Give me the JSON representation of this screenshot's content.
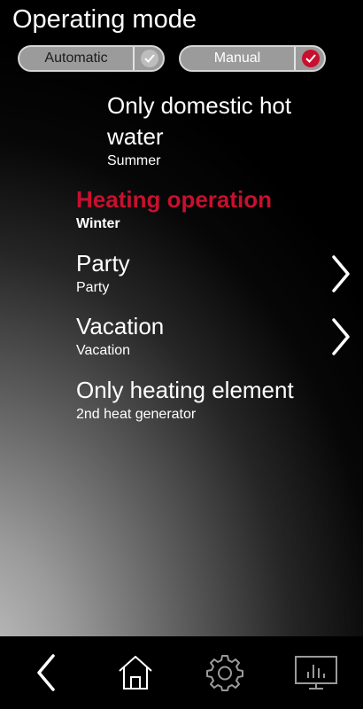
{
  "header": {
    "title": "Operating mode"
  },
  "mode_toggle": {
    "automatic_label": "Automatic",
    "manual_label": "Manual",
    "selected": "Manual"
  },
  "modes": [
    {
      "title_line1": "Only domestic hot",
      "title_line2": "water",
      "subtitle": "Summer",
      "active": false,
      "has_submenu": false
    },
    {
      "title": "Heating operation",
      "subtitle": "Winter",
      "active": true,
      "has_submenu": false
    },
    {
      "title": "Party",
      "subtitle": "Party",
      "active": false,
      "has_submenu": true
    },
    {
      "title": "Vacation",
      "subtitle": "Vacation",
      "active": false,
      "has_submenu": true
    },
    {
      "title": "Only heating element",
      "subtitle": "2nd heat generator",
      "active": false,
      "has_submenu": false
    }
  ],
  "navbar": {
    "icons": [
      "back-icon",
      "home-icon",
      "settings-gear-icon",
      "statistics-monitor-icon"
    ]
  },
  "colors": {
    "accent_red": "#c8102e",
    "text": "#ffffff",
    "toggle_fill": "#9b9b9b"
  }
}
